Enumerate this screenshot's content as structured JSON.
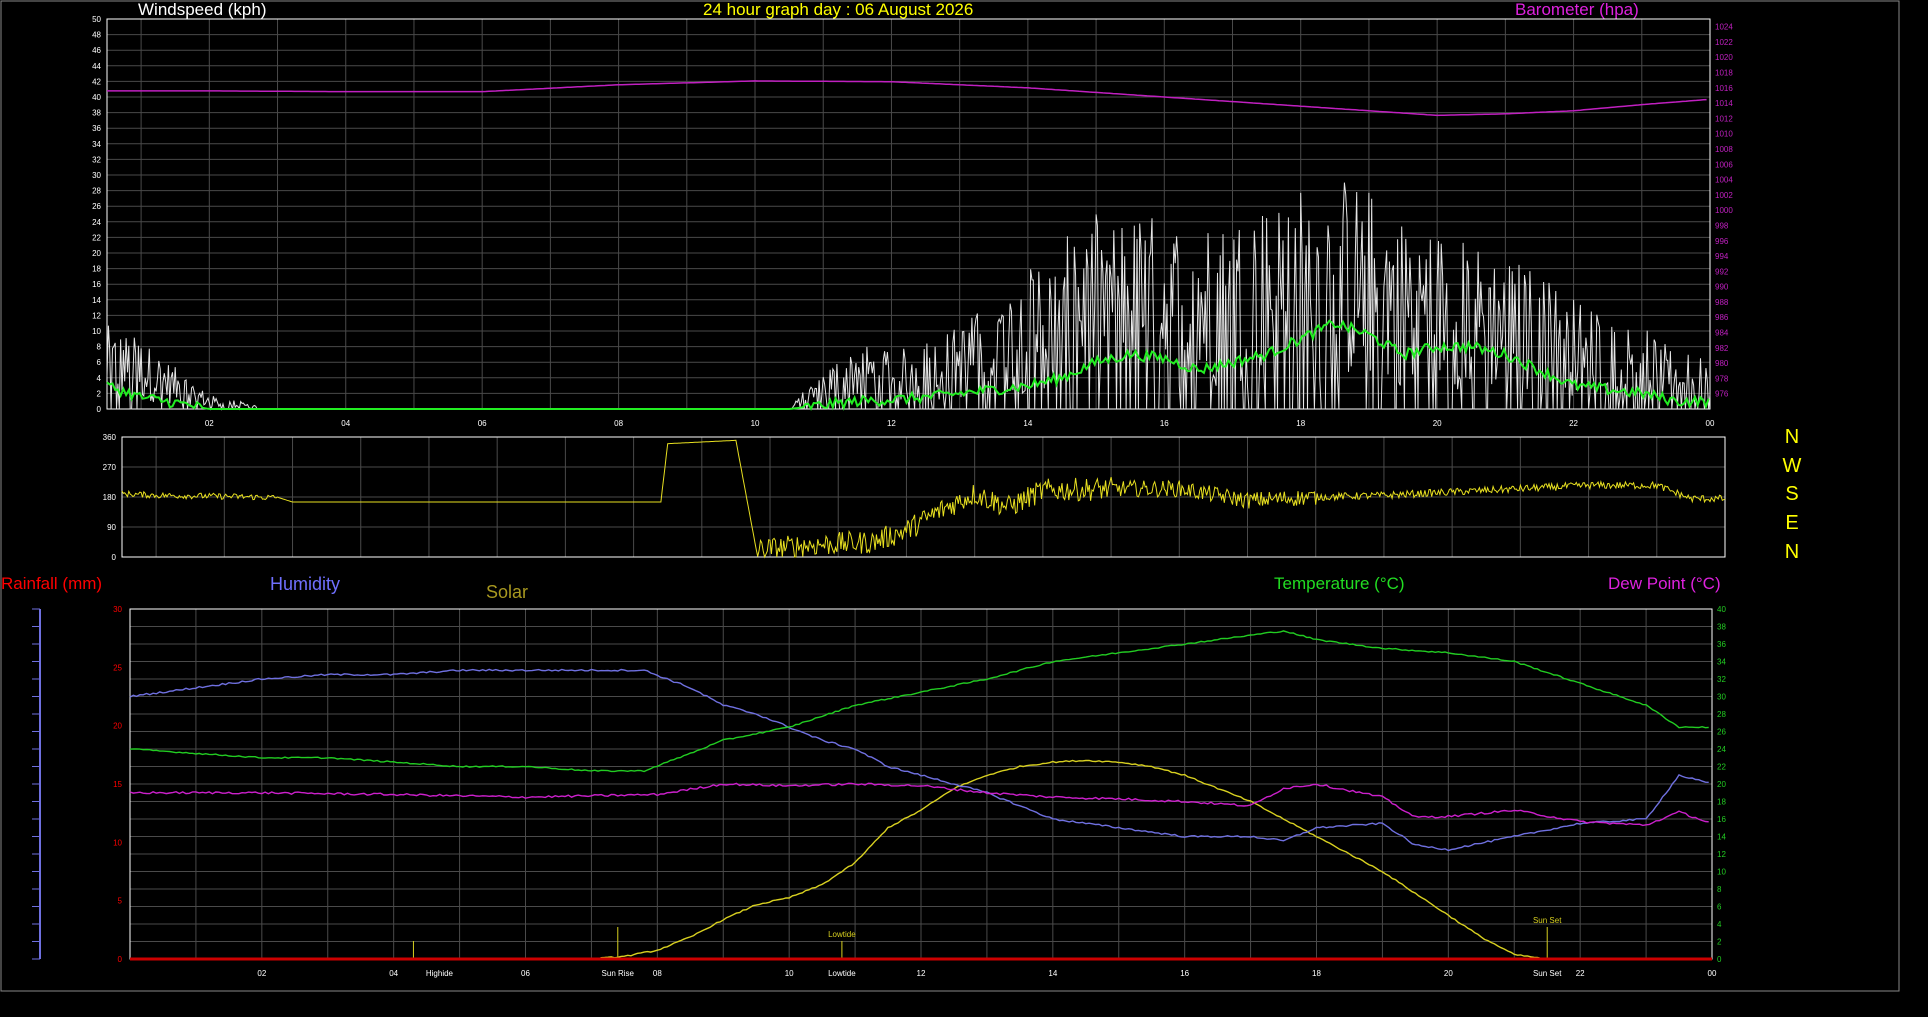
{
  "header": {
    "wind_title": "Windspeed (kph)",
    "graph_title": "24 hour graph day : 06 August 2026",
    "baro_title": "Barometer (hpa)"
  },
  "lower_labels": {
    "rain": "Rainfall (mm)",
    "humidity": "Humidity",
    "solar": "Solar",
    "temperature": "Temperature (°C)",
    "dewpoint": "Dew Point (°C)"
  },
  "compass": [
    "N",
    "W",
    "S",
    "E",
    "N"
  ],
  "colors": {
    "background": "#000000",
    "grid": "#4a4a4a",
    "axis": "#ffffff",
    "wind_speed": "#e6e6e6",
    "wind_avg": "#22ee22",
    "barometer": "#c020c0",
    "wind_dir": "#e8e020",
    "humidity": "#6f70e0",
    "temperature": "#22cc22",
    "dewpoint": "#cc20cc",
    "solar": "#d8d020",
    "rain": "#cc0000",
    "title_yellow": "#ffff00",
    "rain_label": "#ff0000",
    "humidity_label": "#7070ff",
    "solar_label": "#a89820",
    "temp_label": "#22dd22",
    "dew_label": "#dd22dd",
    "baro_label": "#dd22dd"
  },
  "chart_data": [
    {
      "id": "wind",
      "type": "line",
      "title": "24 hour graph day : 06 August 2026",
      "x_tick_labels": [
        "02",
        "04",
        "06",
        "08",
        "10",
        "12",
        "14",
        "16",
        "18",
        "20",
        "22",
        "00"
      ],
      "x_range_hours": [
        0.5,
        24.0
      ],
      "left_axis": {
        "label": "Windspeed (kph)",
        "ylim": [
          0,
          50
        ],
        "ticks": [
          0,
          2,
          4,
          6,
          8,
          10,
          12,
          14,
          16,
          18,
          20,
          22,
          24,
          26,
          28,
          30,
          32,
          34,
          36,
          38,
          40,
          42,
          44,
          46,
          48,
          50
        ]
      },
      "right_axis": {
        "label": "Barometer (hpa)",
        "ylim": [
          974,
          1025
        ],
        "ticks": [
          976,
          978,
          980,
          982,
          984,
          986,
          988,
          990,
          992,
          994,
          996,
          998,
          1000,
          1002,
          1004,
          1006,
          1008,
          1010,
          1012,
          1014,
          1016,
          1018,
          1020,
          1022,
          1024
        ]
      },
      "series": [
        {
          "name": "Barometer (hpa)",
          "axis": "right",
          "x": [
            0.5,
            2,
            4,
            6,
            8,
            10,
            12,
            14,
            16,
            18,
            20,
            21,
            22,
            23,
            24
          ],
          "values": [
            1015.6,
            1015.6,
            1015.5,
            1015.5,
            1016.4,
            1016.9,
            1016.8,
            1016.0,
            1014.8,
            1013.6,
            1012.4,
            1012.6,
            1013.0,
            1013.8,
            1014.5
          ]
        },
        {
          "name": "Windspeed (kph)",
          "axis": "left",
          "x": [
            0.5,
            1,
            1.5,
            2,
            3,
            4,
            5,
            6,
            7,
            8,
            9,
            10,
            10.5,
            11,
            11.5,
            12,
            12.5,
            13,
            13.5,
            14,
            14.5,
            15,
            15.5,
            16,
            16.5,
            17,
            17.5,
            18,
            18.5,
            19,
            19.5,
            20,
            20.5,
            21,
            21.5,
            22,
            22.5,
            23,
            23.5,
            24
          ],
          "values": [
            6,
            5,
            3,
            1,
            0,
            0,
            0,
            0,
            0,
            0,
            0,
            0,
            0,
            3,
            5,
            4,
            5,
            6,
            8,
            10,
            12,
            14,
            14,
            14,
            13,
            14,
            15,
            16,
            17,
            16,
            14,
            13,
            12,
            11,
            10,
            8,
            7,
            6,
            4,
            4
          ]
        },
        {
          "name": "Average wind (kph)",
          "axis": "left",
          "x": [
            0.5,
            1,
            1.5,
            2,
            3,
            4,
            5,
            6,
            7,
            8,
            9,
            10,
            10.5,
            11,
            11.5,
            12,
            12.5,
            13,
            13.5,
            14,
            14.5,
            15,
            15.5,
            16,
            16.5,
            17,
            17.5,
            18,
            18.5,
            19,
            19.5,
            20,
            20.5,
            21,
            21.5,
            22,
            22.5,
            23,
            23.5,
            24
          ],
          "values": [
            3,
            1.5,
            0.8,
            0,
            0,
            0,
            0,
            0,
            0,
            0,
            0,
            0,
            0,
            0.5,
            1,
            1.2,
            1.5,
            2,
            2.5,
            3,
            4,
            6,
            7,
            6.5,
            5,
            6,
            7,
            9,
            11,
            9.5,
            7,
            8,
            8,
            7,
            5,
            3,
            2.5,
            2,
            1,
            1
          ]
        }
      ]
    },
    {
      "id": "wind_direction",
      "type": "line",
      "x_range_hours": [
        0.5,
        24.0
      ],
      "ylim": [
        0,
        360
      ],
      "y_ticks": [
        0,
        90,
        180,
        270,
        360
      ],
      "side_labels": [
        "N",
        "W",
        "S",
        "E",
        "N"
      ],
      "series": [
        {
          "name": "Wind direction",
          "x": [
            0.5,
            1,
            2,
            2.8,
            3,
            4,
            5,
            6,
            7,
            8,
            8.4,
            8.5,
            9,
            9.5,
            9.8,
            10,
            10.5,
            11,
            11.5,
            12,
            12.5,
            13,
            13.5,
            14,
            15,
            16,
            17,
            18,
            19,
            20,
            21,
            22,
            23,
            23.5,
            24
          ],
          "values": [
            190,
            185,
            182,
            178,
            165,
            165,
            165,
            165,
            165,
            165,
            165,
            340,
            345,
            350,
            20,
            25,
            35,
            40,
            45,
            80,
            140,
            190,
            150,
            200,
            205,
            205,
            170,
            180,
            185,
            195,
            205,
            215,
            215,
            175,
            175
          ]
        }
      ]
    },
    {
      "id": "climate",
      "type": "line",
      "x_tick_labels": [
        "02",
        "04",
        "06",
        "08",
        "10",
        "12",
        "14",
        "16",
        "18",
        "20",
        "22",
        "00"
      ],
      "x_range_hours": [
        0.0,
        24.0
      ],
      "left_axis": {
        "label": "Rainfall (mm)",
        "ylim": [
          0,
          30
        ],
        "ticks": [
          0,
          5,
          10,
          15,
          20,
          25,
          30
        ]
      },
      "right_axis": {
        "label": "Temperature (°C)",
        "ylim": [
          0,
          40
        ],
        "ticks": [
          0,
          2,
          4,
          6,
          8,
          10,
          12,
          14,
          16,
          18,
          20,
          22,
          24,
          26,
          28,
          30,
          32,
          34,
          36,
          38,
          40
        ]
      },
      "annotations": [
        {
          "text": "Sun Rise",
          "hour": 7.4
        },
        {
          "text": "Sun Set",
          "hour": 21.5
        },
        {
          "text": "Highide",
          "hour": 4.3
        },
        {
          "text": "Lowtide",
          "hour": 10.8
        }
      ],
      "series": [
        {
          "name": "Humidity",
          "axis": "temp",
          "x": [
            0,
            1,
            2,
            3,
            4,
            5,
            6,
            7,
            7.8,
            8.5,
            9,
            9.5,
            10,
            10.5,
            11,
            11.5,
            12,
            12.5,
            13,
            14,
            15,
            16,
            17,
            17.5,
            18,
            19,
            19.5,
            20,
            21,
            22,
            23,
            23.5,
            24
          ],
          "values": [
            30,
            31,
            32,
            32.5,
            32.5,
            33,
            33,
            33,
            33,
            31,
            29,
            28,
            26.5,
            25,
            24,
            22,
            21,
            20,
            19,
            16,
            15,
            14,
            14,
            13.5,
            15,
            15.5,
            13,
            12.5,
            14,
            15.5,
            16,
            21,
            20
          ]
        },
        {
          "name": "Temperature (°C)",
          "axis": "temp",
          "x": [
            0,
            1,
            2,
            3,
            4,
            5,
            6,
            7,
            7.8,
            8.5,
            9,
            10,
            11,
            12,
            13,
            14,
            15,
            16,
            17,
            17.5,
            18,
            19,
            20,
            21,
            22,
            23,
            23.5,
            24
          ],
          "values": [
            24,
            23.5,
            23,
            23,
            22.5,
            22,
            22,
            21.5,
            21.5,
            23.5,
            25,
            26.5,
            29,
            30.5,
            32,
            34,
            35,
            36,
            37,
            37.5,
            36.5,
            35.5,
            35,
            34,
            31.5,
            29,
            26.5,
            26.5
          ]
        },
        {
          "name": "Dew Point (°C)",
          "axis": "temp",
          "x": [
            0,
            2,
            4,
            6,
            8,
            9,
            10,
            11,
            12,
            13,
            14,
            15,
            16,
            17,
            17.5,
            18,
            19,
            19.5,
            20,
            21,
            22,
            23,
            23.5,
            24
          ],
          "values": [
            19,
            19,
            18.8,
            18.5,
            18.8,
            20,
            19.8,
            20,
            19.8,
            19,
            18.5,
            18.3,
            18,
            17.5,
            19.5,
            20,
            18.5,
            16.2,
            16.3,
            17,
            15.7,
            15.3,
            16.8,
            15.5
          ]
        },
        {
          "name": "Solar",
          "axis": "temp",
          "x": [
            0,
            7,
            7.5,
            8,
            8.5,
            9,
            9.5,
            10,
            10.5,
            11,
            11.5,
            12,
            12.5,
            13,
            13.5,
            14,
            14.5,
            15,
            15.5,
            16,
            16.5,
            17,
            18,
            19,
            20,
            20.5,
            21,
            21.5,
            22,
            24
          ],
          "values": [
            0,
            0,
            0.3,
            1,
            2.5,
            4.5,
            6.2,
            7,
            8.5,
            11,
            15,
            17,
            19.5,
            21,
            22,
            22.5,
            22.7,
            22.5,
            22,
            21,
            19.5,
            18,
            14,
            10,
            5,
            2.5,
            0.5,
            0,
            0,
            0
          ]
        },
        {
          "name": "Rainfall (mm)",
          "axis": "rain",
          "x": [
            0,
            24
          ],
          "values": [
            0,
            0
          ]
        }
      ]
    }
  ]
}
